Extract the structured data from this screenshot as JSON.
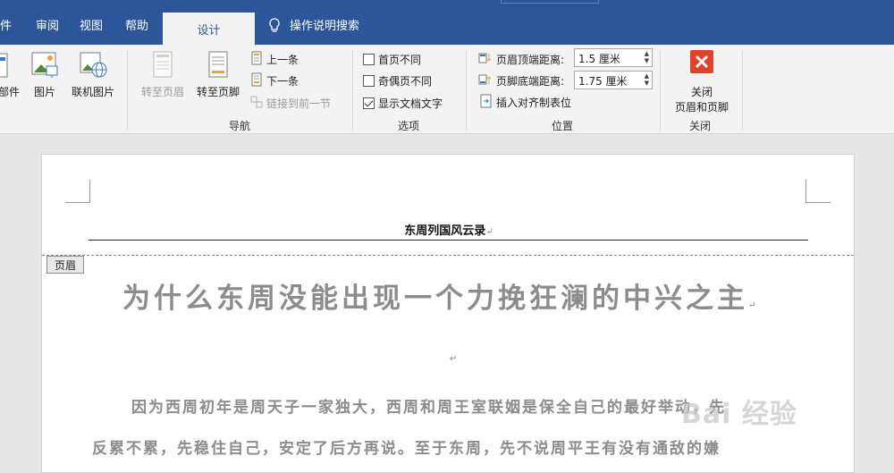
{
  "tabs": {
    "items": [
      "件",
      "审阅",
      "视图",
      "帮助"
    ],
    "active": "设计",
    "tell_me": "操作说明搜索"
  },
  "ribbon": {
    "insert_group": {
      "parts_label": "部件",
      "picture_label": "图片",
      "online_picture_label": "联机图片"
    },
    "nav_group": {
      "goto_header": "转至页眉",
      "goto_footer": "转至页脚",
      "previous": "上一条",
      "next": "下一条",
      "link_previous": "链接到前一节",
      "label": "导航"
    },
    "options_group": {
      "diff_first_page": "首页不同",
      "diff_odd_even": "奇偶页不同",
      "show_doc_text": "显示文档文字",
      "label": "选项"
    },
    "position_group": {
      "header_from_top": "页眉顶端距离:",
      "header_from_top_value": "1.5 厘米",
      "footer_from_bottom": "页脚底端距离:",
      "footer_from_bottom_value": "1.75 厘米",
      "insert_align_tab": "插入对齐制表位",
      "label": "位置"
    },
    "close_group": {
      "close_line1": "关闭",
      "close_line2": "页眉和页脚",
      "label": "关闭"
    }
  },
  "document": {
    "header_text": "东周列国风云录",
    "header_tag": "页眉",
    "title": "为什么东周没能出现一个力挽狂澜的中兴之主",
    "line1": "因为西周初年是周天子一家独大，西周和周王室联姻是保全自己的最好举动，先",
    "line2": "反累不累，先稳住自己，安定了后方再说。至于东周，先不说周平王有没有通敌的嫌",
    "watermark": "Bai 经验"
  },
  "colors": {
    "ribbon_blue": "#2b579a",
    "close_red": "#e0432c"
  }
}
